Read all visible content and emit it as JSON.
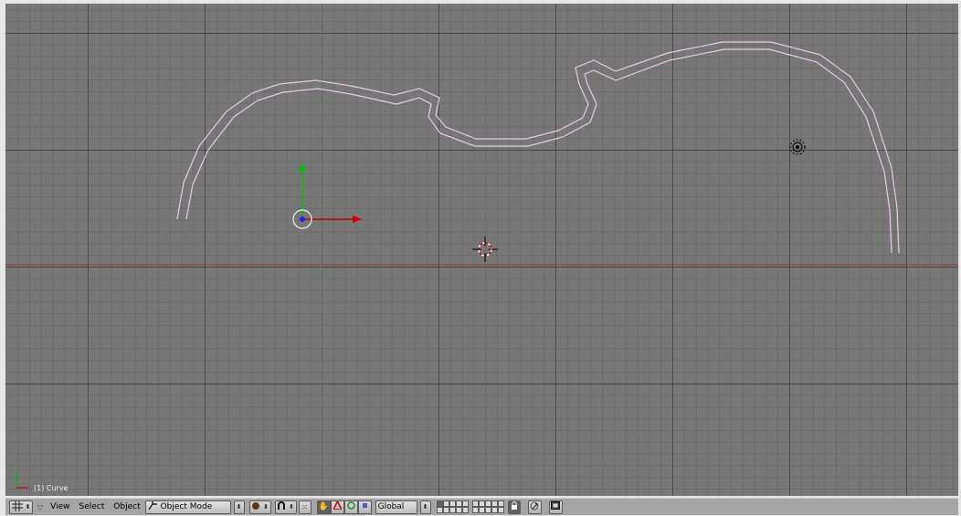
{
  "viewport": {
    "object_label": "(1) Curve",
    "colors": {
      "background": "#777777",
      "curve": "#e8c8e8",
      "axis_x": "#cc0000",
      "axis_y": "#00cc00",
      "object_origin": "#2222ff"
    }
  },
  "header": {
    "view_type_icon": "grid-icon",
    "menus": [
      "View",
      "Select",
      "Object"
    ],
    "mode_select": {
      "value": "Object Mode",
      "icon": "object-mode-icon"
    },
    "shading_icon": "solid-shading-icon",
    "pivot_icon": "pivot-icon",
    "manipulator_toggle_icons": [
      "hand-icon",
      "translate-icon",
      "rotate-icon",
      "scale-icon"
    ],
    "orientation_select": {
      "value": "Global"
    },
    "layer_count": 20,
    "lock_icon": "lock-icon",
    "snap_icon": "snap-icon",
    "render_icon": "render-icon"
  }
}
